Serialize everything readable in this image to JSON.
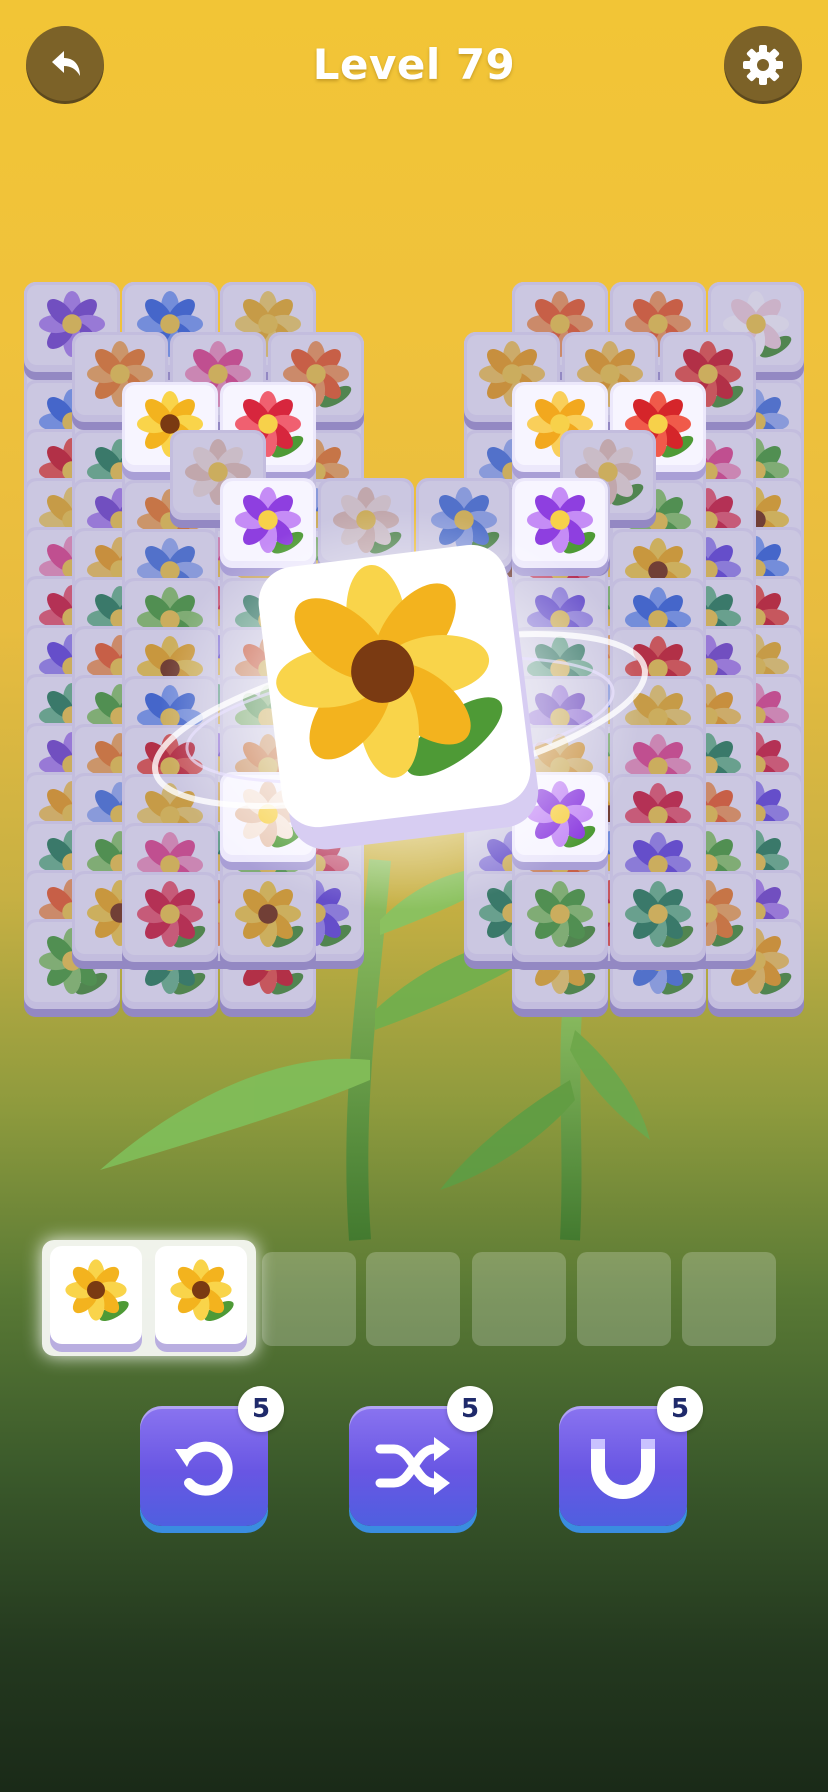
{
  "header": {
    "level_title": "Level 79"
  },
  "tray": {
    "capacity": 7,
    "filled": [
      "sunflower",
      "sunflower"
    ]
  },
  "boosters": [
    {
      "name": "undo",
      "count": "5"
    },
    {
      "name": "shuffle",
      "count": "5"
    },
    {
      "name": "magnet",
      "count": "5"
    }
  ],
  "board": {
    "left_stack": [
      [
        "iris",
        "blue-flower",
        "daffodil"
      ],
      [
        "orange-marigold",
        "pink-flower",
        "orange-poppy"
      ],
      [
        "sunflower",
        "red-rose"
      ],
      [
        "calla-lily"
      ],
      [
        "purple-flower"
      ]
    ],
    "right_stack": [
      [
        "orange-poppy",
        "orange-poppy",
        "apple-blossom"
      ],
      [
        "tulip",
        "tulip",
        "red-poppy"
      ],
      [
        "tulip",
        "red-poppy"
      ],
      [
        "calla-lily"
      ],
      [
        "purple-flower"
      ]
    ],
    "center": [
      "calla-lily",
      "hydrangea",
      "hydrangea"
    ],
    "selected_tile": "sunflower"
  },
  "colors": {
    "bg_top": "#f2c536",
    "tile_face": "#ffffff",
    "tile_side": "#b9aee0",
    "booster": "#6856e3",
    "circle_button": "#7c6228"
  }
}
